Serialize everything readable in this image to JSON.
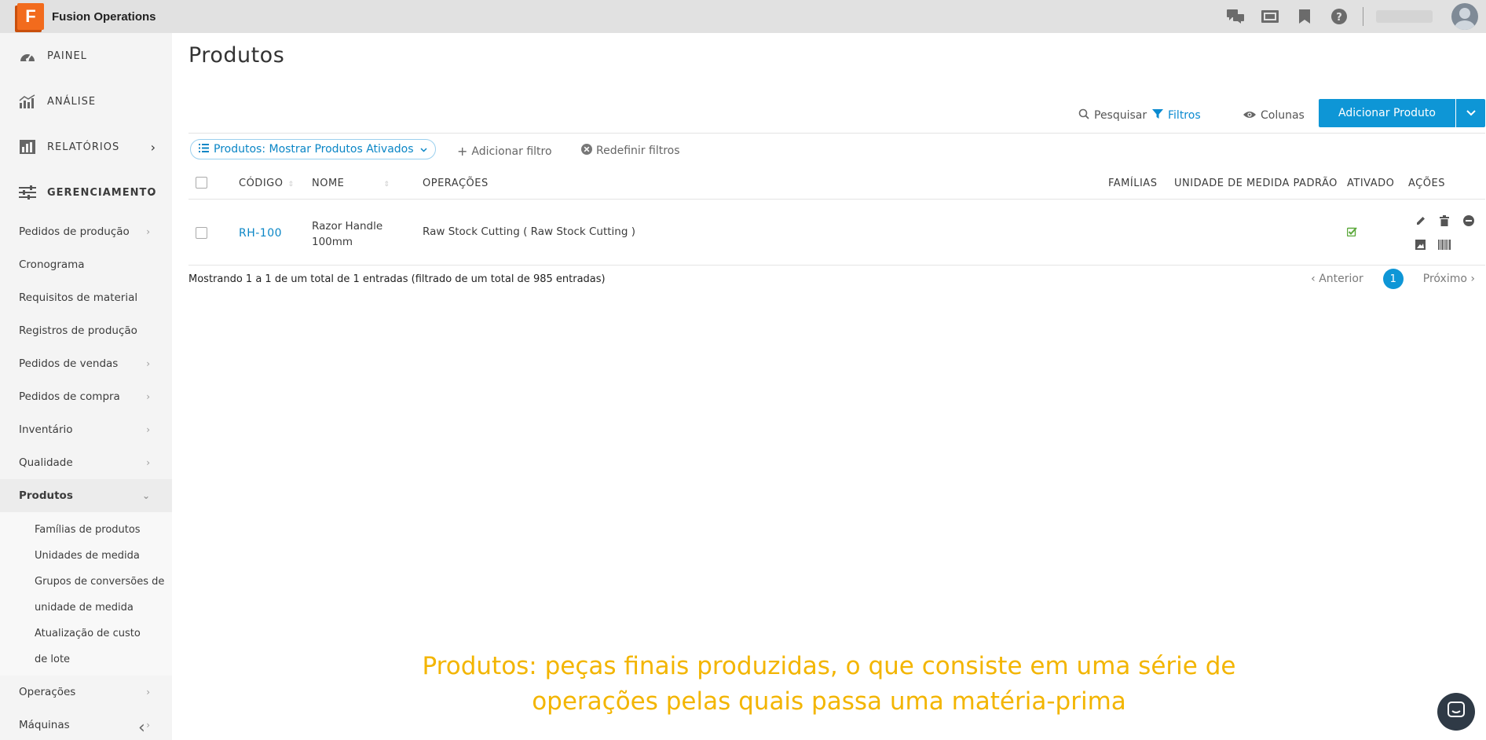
{
  "app": {
    "title": "Fusion Operations",
    "logo_letter": "F"
  },
  "topbar": {
    "icons": [
      "chat-icon",
      "monitor-icon",
      "bookmark-icon",
      "help-icon"
    ]
  },
  "sidebar": {
    "top_items": [
      {
        "label": "PAINEL",
        "icon": "dashboard-icon"
      },
      {
        "label": "ANÁLISE",
        "icon": "analytics-icon"
      },
      {
        "label": "RELATÓRIOS",
        "icon": "reports-icon",
        "chevron": "›"
      },
      {
        "label": "GERENCIAMENTO",
        "icon": "settings-sliders-icon",
        "chevron": "⌄"
      }
    ],
    "items": [
      {
        "label": "Pedidos de produção",
        "chevron": "›"
      },
      {
        "label": "Cronograma"
      },
      {
        "label": "Requisitos de material"
      },
      {
        "label": "Registros de produção"
      },
      {
        "label": "Pedidos de vendas",
        "chevron": "›"
      },
      {
        "label": "Pedidos de compra",
        "chevron": "›"
      },
      {
        "label": "Inventário",
        "chevron": "›"
      },
      {
        "label": "Qualidade",
        "chevron": "›"
      },
      {
        "label": "Produtos",
        "chevron": "⌄"
      }
    ],
    "subitems": [
      {
        "label": "Famílias de produtos"
      },
      {
        "label": "Unidades de medida"
      },
      {
        "label": "Grupos de conversões de unidade de medida"
      },
      {
        "label": "Atualização de custo de lote"
      }
    ],
    "bottom_items": [
      {
        "label": "Operações",
        "chevron": "›"
      },
      {
        "label": "Máquinas",
        "chevron": "›"
      }
    ],
    "collapse": "‹"
  },
  "page": {
    "title": "Produtos"
  },
  "toolbar": {
    "search": "Pesquisar",
    "filters": "Filtros",
    "columns": "Colunas",
    "add_product": "Adicionar Produto"
  },
  "filters": {
    "active_chip": "Produtos: Mostrar Produtos Ativados",
    "add_filter": "Adicionar filtro",
    "reset_filters": "Redefinir filtros"
  },
  "table": {
    "headers": {
      "code": "CÓDIGO",
      "name": "NOME",
      "operations": "OPERAÇÕES",
      "families": "FAMÍLIAS",
      "uom": "UNIDADE DE MEDIDA PADRÃO",
      "enabled": "ATIVADO",
      "actions": "AÇÕES"
    },
    "rows": [
      {
        "code": "RH-100",
        "name": "Razor Handle 100mm",
        "operations": "Raw Stock Cutting ( Raw Stock Cutting )",
        "families": "",
        "uom": "",
        "enabled": true
      }
    ]
  },
  "footer": {
    "info": "Mostrando 1 a 1 de um total de 1 entradas (filtrado de um total de 985 entradas)",
    "prev": "Anterior",
    "current_page": "1",
    "next": "Próximo"
  },
  "caption": {
    "line1": "Produtos: peças finais produzidas, o que consiste em uma série de",
    "line2": "operações pelas quais passa uma matéria-prima"
  },
  "colors": {
    "accent": "#0e96d6",
    "caption": "#f3b500",
    "logo": "#f26b1d"
  }
}
